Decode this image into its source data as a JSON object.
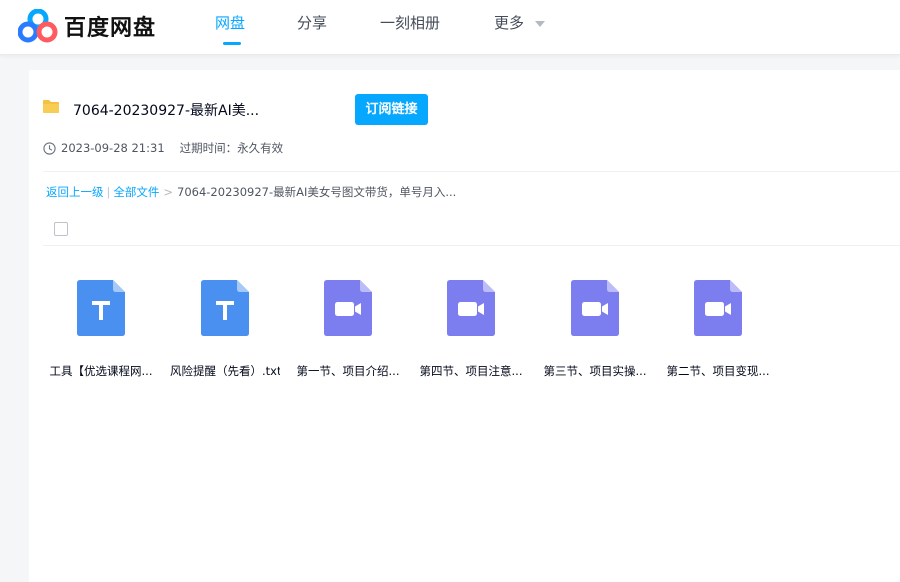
{
  "header": {
    "logo_text": "百度网盘",
    "nav": [
      {
        "label": "网盘",
        "active": true
      },
      {
        "label": "分享",
        "active": false
      },
      {
        "label": "一刻相册",
        "active": false
      },
      {
        "label": "更多",
        "active": false
      }
    ]
  },
  "share": {
    "title": "7064-20230927-最新AI美...",
    "subscribe_label": "订阅链接",
    "date": "2023-09-28 21:31",
    "expire": "过期时间：永久有效"
  },
  "breadcrumb": {
    "back": "返回上一级",
    "sep": "|",
    "all_files": "全部文件",
    "gt": ">",
    "current": "7064-20230927-最新AI美女号图文带货，单号月入..."
  },
  "files": [
    {
      "name": "工具【优选课程网...",
      "type": "txt-icon"
    },
    {
      "name": "风险提醒（先看）.txt",
      "type": "txt-icon"
    },
    {
      "name": "第一节、项目介绍...",
      "type": "video-icon"
    },
    {
      "name": "第四节、项目注意...",
      "type": "video-icon"
    },
    {
      "name": "第三节、项目实操...",
      "type": "video-icon"
    },
    {
      "name": "第二节、项目变现...",
      "type": "video-icon"
    }
  ],
  "colors": {
    "accent": "#06a7ff",
    "txt_icon": "#4a90f0",
    "video_icon": "#7c7ef0",
    "folder": "#f5c142"
  }
}
